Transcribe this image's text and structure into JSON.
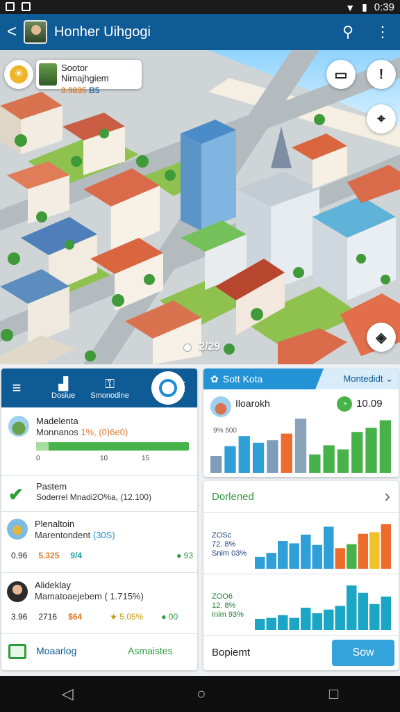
{
  "status_bar": {
    "time": "0:39"
  },
  "app_bar": {
    "back_glyph": "<",
    "title": "Honher Uihgogi",
    "search_glyph": "⚲",
    "more_glyph": "⋮"
  },
  "map": {
    "card_title": "Sootor Nimajhgiem",
    "card_sub_a": "3.9835",
    "card_sub_b": "B5",
    "clipboard_glyph": "▭",
    "alert_glyph": "!",
    "locate_glyph": "⌖",
    "nav_glyph": "◈",
    "page_label": "2/29"
  },
  "left_panel": {
    "menu_glyph": "≡",
    "tabs": [
      {
        "glyph": "▟",
        "label": "Dosiue"
      },
      {
        "glyph": "⚿",
        "label": "Smonodine"
      }
    ],
    "more_glyph": "⋮",
    "progress_row": {
      "title": "Madelenta",
      "subtitle": "Monnanos",
      "subtitle_value": "1%, (0)6e0)",
      "fill": 1.0,
      "ticks": [
        "0",
        "10",
        "15"
      ]
    },
    "check_row": {
      "title": "Pastem",
      "subtitle": "Soderrel Mnadi2O%a, (12.100)"
    },
    "items": [
      {
        "title": "Plenaltoin",
        "subtitle": "Marentondent",
        "subtitle_value": "(30S)",
        "stats": [
          "0.96",
          "5.325",
          "9/4",
          "● 93"
        ]
      },
      {
        "title": "Alideklay",
        "subtitle": "Mamatoaejebem",
        "subtitle_value": "( 1.715%)",
        "stats": [
          "3.96",
          "2716",
          "$64",
          "★ 5.05%",
          "● 00"
        ]
      }
    ],
    "footer": {
      "left_label": "Moaarlog",
      "right_label": "Asmaistes"
    }
  },
  "right_panel": {
    "header_label": "Sott Kota",
    "header_select": "Montedidt ⌄",
    "profile": {
      "name": "Iloarokh",
      "sub": "9% 500",
      "value": "10.09"
    },
    "chart1": [
      {
        "v": 2.0,
        "c": "#7f9cb8"
      },
      {
        "v": 3.2,
        "c": "#2f9fd8"
      },
      {
        "v": 4.4,
        "c": "#2f9fd8"
      },
      {
        "v": 3.6,
        "c": "#2f9fd8"
      },
      {
        "v": 3.9,
        "c": "#7f9cb8"
      },
      {
        "v": 4.7,
        "c": "#ee6b2e"
      },
      {
        "v": 6.5,
        "c": "#8aa3bb"
      },
      {
        "v": 2.2,
        "c": "#48b24a"
      },
      {
        "v": 3.3,
        "c": "#48b24a"
      },
      {
        "v": 2.8,
        "c": "#48b24a"
      },
      {
        "v": 4.9,
        "c": "#48b24a"
      },
      {
        "v": 5.4,
        "c": "#48b24a"
      },
      {
        "v": 6.3,
        "c": "#48b24a"
      }
    ],
    "section_label": "Dorlened",
    "chevron_glyph": "›",
    "chart2": {
      "line1": "ZOSc",
      "line2": "72. 8%",
      "line3": "Snim 03%",
      "bars": [
        {
          "v": 1.5,
          "c": "#2f9fd8"
        },
        {
          "v": 2.0,
          "c": "#2f9fd8"
        },
        {
          "v": 3.5,
          "c": "#2f9fd8"
        },
        {
          "v": 3.2,
          "c": "#2f9fd8"
        },
        {
          "v": 4.3,
          "c": "#2f9fd8"
        },
        {
          "v": 3.0,
          "c": "#2f9fd8"
        },
        {
          "v": 5.3,
          "c": "#2f9fd8"
        },
        {
          "v": 2.6,
          "c": "#ee6b2e"
        },
        {
          "v": 3.1,
          "c": "#48b24a"
        },
        {
          "v": 4.4,
          "c": "#ee6b2e"
        },
        {
          "v": 4.6,
          "c": "#f0c12a"
        },
        {
          "v": 5.6,
          "c": "#ee6b2e"
        }
      ]
    },
    "chart3": {
      "line1": "ZOO6",
      "line2": "12. 8%",
      "line3": "Inim 93%",
      "bars": [
        {
          "v": 1.2,
          "c": "#1aa6c4"
        },
        {
          "v": 1.3,
          "c": "#1aa6c4"
        },
        {
          "v": 1.6,
          "c": "#1aa6c4"
        },
        {
          "v": 1.3,
          "c": "#1aa6c4"
        },
        {
          "v": 2.4,
          "c": "#1aa6c4"
        },
        {
          "v": 1.8,
          "c": "#1aa6c4"
        },
        {
          "v": 2.2,
          "c": "#1aa6c4"
        },
        {
          "v": 2.6,
          "c": "#1aa6c4"
        },
        {
          "v": 4.8,
          "c": "#1aa6c4"
        },
        {
          "v": 4.0,
          "c": "#1aa6c4"
        },
        {
          "v": 2.8,
          "c": "#1aa6c4"
        },
        {
          "v": 3.6,
          "c": "#1aa6c4"
        }
      ]
    },
    "footer": {
      "left_label": "Bopiemt",
      "button_label": "Sow"
    }
  },
  "nav_bar": {
    "back_glyph": "◁",
    "home_glyph": "○",
    "recents_glyph": "□"
  }
}
